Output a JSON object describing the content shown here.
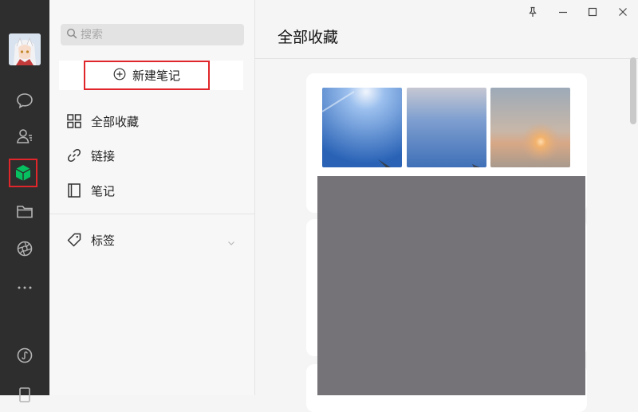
{
  "search": {
    "placeholder": "搜索"
  },
  "sidebar": {
    "new_note_label": "新建笔记",
    "items": [
      {
        "label": "全部收藏",
        "icon": "grid-icon"
      },
      {
        "label": "链接",
        "icon": "link-icon"
      },
      {
        "label": "笔记",
        "icon": "notebook-icon"
      }
    ],
    "tags": {
      "label": "标签",
      "icon": "tag-icon"
    }
  },
  "main": {
    "title": "全部收藏"
  },
  "nav": {
    "icons": [
      "chat-icon",
      "contacts-icon",
      "favorites-cube-icon",
      "folder-icon",
      "moments-icon",
      "more-icon",
      "mini-program-icon",
      "phone-icon"
    ],
    "active": "favorites-cube-icon"
  },
  "window_controls": [
    "pin-icon",
    "minimize-icon",
    "maximize-icon",
    "close-icon"
  ],
  "colors": {
    "accent": "#07c160",
    "highlight": "#e0262b",
    "nav_bg": "#2e2e2e"
  }
}
